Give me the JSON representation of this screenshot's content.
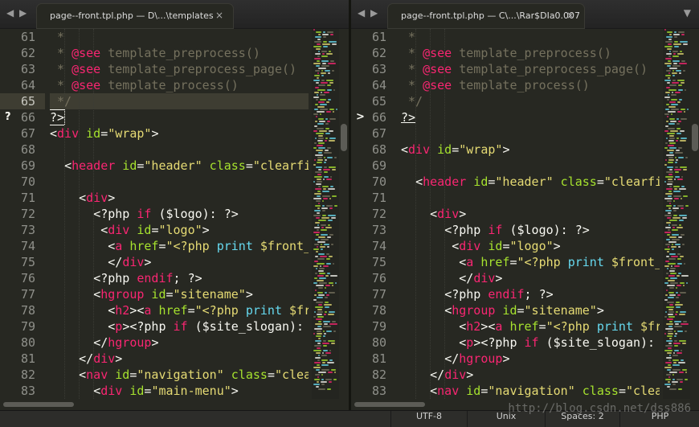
{
  "panes": [
    {
      "tab": {
        "label": "page--front.tpl.php — D\\...\\templates"
      },
      "marker": {
        "line": 66,
        "glyph": "?"
      },
      "active_line": 65,
      "line_numbers": [
        61,
        62,
        63,
        64,
        65,
        66,
        67,
        68,
        69,
        70,
        71,
        72,
        73,
        74,
        75,
        76,
        77,
        78,
        79,
        80,
        81,
        82,
        83
      ],
      "code": [
        {
          "indent": " ",
          "tokens": [
            {
              "c": "cm",
              "t": "*"
            }
          ]
        },
        {
          "indent": " ",
          "tokens": [
            {
              "c": "cm",
              "t": "* "
            },
            {
              "c": "kw",
              "t": "@see"
            },
            {
              "c": "cm",
              "t": " template_preprocess()"
            }
          ]
        },
        {
          "indent": " ",
          "tokens": [
            {
              "c": "cm",
              "t": "* "
            },
            {
              "c": "kw",
              "t": "@see"
            },
            {
              "c": "cm",
              "t": " template_preprocess_page()"
            }
          ]
        },
        {
          "indent": " ",
          "tokens": [
            {
              "c": "cm",
              "t": "* "
            },
            {
              "c": "kw",
              "t": "@see"
            },
            {
              "c": "cm",
              "t": " template_process()"
            }
          ]
        },
        {
          "indent": " ",
          "tokens": [
            {
              "c": "cm",
              "t": "*/"
            }
          ]
        },
        {
          "indent": "",
          "tokens": [
            {
              "c": "tx",
              "t": "?>",
              "caret": true
            }
          ]
        },
        {
          "indent": "",
          "tokens": [
            {
              "c": "tx",
              "t": "<"
            },
            {
              "c": "kw",
              "t": "div"
            },
            {
              "c": "at",
              "t": " id"
            },
            {
              "c": "tx",
              "t": "="
            },
            {
              "c": "st",
              "t": "\"wrap\""
            },
            {
              "c": "tx",
              "t": ">"
            }
          ]
        },
        {
          "indent": "",
          "tokens": []
        },
        {
          "indent": "  ",
          "tokens": [
            {
              "c": "tx",
              "t": "<"
            },
            {
              "c": "kw",
              "t": "header"
            },
            {
              "c": "at",
              "t": " id"
            },
            {
              "c": "tx",
              "t": "="
            },
            {
              "c": "st",
              "t": "\"header\""
            },
            {
              "c": "at",
              "t": " class"
            },
            {
              "c": "tx",
              "t": "="
            },
            {
              "c": "st",
              "t": "\"clearfi"
            }
          ]
        },
        {
          "indent": "",
          "tokens": []
        },
        {
          "indent": "    ",
          "tokens": [
            {
              "c": "tx",
              "t": "<"
            },
            {
              "c": "kw",
              "t": "div"
            },
            {
              "c": "tx",
              "t": ">"
            }
          ]
        },
        {
          "indent": "      ",
          "tokens": [
            {
              "c": "tx",
              "t": "<?php "
            },
            {
              "c": "kw",
              "t": "if"
            },
            {
              "c": "tx",
              "t": " ($logo): ?>"
            }
          ]
        },
        {
          "indent": "       ",
          "tokens": [
            {
              "c": "tx",
              "t": "<"
            },
            {
              "c": "kw",
              "t": "div"
            },
            {
              "c": "at",
              "t": " id"
            },
            {
              "c": "tx",
              "t": "="
            },
            {
              "c": "st",
              "t": "\"logo\""
            },
            {
              "c": "tx",
              "t": ">"
            }
          ]
        },
        {
          "indent": "        ",
          "tokens": [
            {
              "c": "tx",
              "t": "<"
            },
            {
              "c": "kw",
              "t": "a"
            },
            {
              "c": "at",
              "t": " href"
            },
            {
              "c": "tx",
              "t": "="
            },
            {
              "c": "st",
              "t": "\"<?php "
            },
            {
              "c": "fn",
              "t": "print"
            },
            {
              "c": "st",
              "t": " $front_"
            }
          ]
        },
        {
          "indent": "        ",
          "tokens": [
            {
              "c": "tx",
              "t": "</"
            },
            {
              "c": "kw",
              "t": "div"
            },
            {
              "c": "tx",
              "t": ">"
            }
          ]
        },
        {
          "indent": "      ",
          "tokens": [
            {
              "c": "tx",
              "t": "<?php "
            },
            {
              "c": "kw",
              "t": "endif"
            },
            {
              "c": "tx",
              "t": "; ?>"
            }
          ]
        },
        {
          "indent": "      ",
          "tokens": [
            {
              "c": "tx",
              "t": "<"
            },
            {
              "c": "kw",
              "t": "hgroup"
            },
            {
              "c": "at",
              "t": " id"
            },
            {
              "c": "tx",
              "t": "="
            },
            {
              "c": "st",
              "t": "\"sitename\""
            },
            {
              "c": "tx",
              "t": ">"
            }
          ]
        },
        {
          "indent": "        ",
          "tokens": [
            {
              "c": "tx",
              "t": "<"
            },
            {
              "c": "kw",
              "t": "h2"
            },
            {
              "c": "tx",
              "t": "><"
            },
            {
              "c": "kw",
              "t": "a"
            },
            {
              "c": "at",
              "t": " href"
            },
            {
              "c": "tx",
              "t": "="
            },
            {
              "c": "st",
              "t": "\"<?php "
            },
            {
              "c": "fn",
              "t": "print"
            },
            {
              "c": "st",
              "t": " $fr"
            }
          ]
        },
        {
          "indent": "        ",
          "tokens": [
            {
              "c": "tx",
              "t": "<"
            },
            {
              "c": "kw",
              "t": "p"
            },
            {
              "c": "tx",
              "t": "><?php "
            },
            {
              "c": "kw",
              "t": "if"
            },
            {
              "c": "tx",
              "t": " ($site_slogan): "
            }
          ]
        },
        {
          "indent": "      ",
          "tokens": [
            {
              "c": "tx",
              "t": "</"
            },
            {
              "c": "kw",
              "t": "hgroup"
            },
            {
              "c": "tx",
              "t": ">"
            }
          ]
        },
        {
          "indent": "    ",
          "tokens": [
            {
              "c": "tx",
              "t": "</"
            },
            {
              "c": "kw",
              "t": "div"
            },
            {
              "c": "tx",
              "t": ">"
            }
          ]
        },
        {
          "indent": "    ",
          "tokens": [
            {
              "c": "tx",
              "t": "<"
            },
            {
              "c": "kw",
              "t": "nav"
            },
            {
              "c": "at",
              "t": " id"
            },
            {
              "c": "tx",
              "t": "="
            },
            {
              "c": "st",
              "t": "\"navigation\""
            },
            {
              "c": "at",
              "t": " class"
            },
            {
              "c": "tx",
              "t": "="
            },
            {
              "c": "st",
              "t": "\"clea"
            }
          ]
        },
        {
          "indent": "      ",
          "tokens": [
            {
              "c": "tx",
              "t": "<"
            },
            {
              "c": "kw",
              "t": "div"
            },
            {
              "c": "at",
              "t": " id"
            },
            {
              "c": "tx",
              "t": "="
            },
            {
              "c": "st",
              "t": "\"main-menu\""
            },
            {
              "c": "tx",
              "t": ">"
            }
          ]
        }
      ]
    },
    {
      "tab": {
        "label": "page--front.tpl.php — C\\...\\Rar$DIa0.007"
      },
      "marker": {
        "line": 66,
        "glyph": ">"
      },
      "active_line": null,
      "line_numbers": [
        61,
        62,
        63,
        64,
        65,
        66,
        67,
        68,
        69,
        70,
        71,
        72,
        73,
        74,
        75,
        76,
        77,
        78,
        79,
        80,
        81,
        82,
        83
      ],
      "code": [
        {
          "indent": " ",
          "tokens": [
            {
              "c": "cm",
              "t": "*"
            }
          ]
        },
        {
          "indent": " ",
          "tokens": [
            {
              "c": "cm",
              "t": "* "
            },
            {
              "c": "kw",
              "t": "@see"
            },
            {
              "c": "cm",
              "t": " template_preprocess()"
            }
          ]
        },
        {
          "indent": " ",
          "tokens": [
            {
              "c": "cm",
              "t": "* "
            },
            {
              "c": "kw",
              "t": "@see"
            },
            {
              "c": "cm",
              "t": " template_preprocess_page()"
            }
          ]
        },
        {
          "indent": " ",
          "tokens": [
            {
              "c": "cm",
              "t": "* "
            },
            {
              "c": "kw",
              "t": "@see"
            },
            {
              "c": "cm",
              "t": " template_process()"
            }
          ]
        },
        {
          "indent": " ",
          "tokens": [
            {
              "c": "cm",
              "t": "*/"
            }
          ]
        },
        {
          "indent": "",
          "tokens": [
            {
              "c": "tx",
              "t": "?>",
              "underline": true
            }
          ]
        },
        {
          "indent": "",
          "tokens": []
        },
        {
          "indent": "",
          "tokens": [
            {
              "c": "tx",
              "t": "<"
            },
            {
              "c": "kw",
              "t": "div"
            },
            {
              "c": "at",
              "t": " id"
            },
            {
              "c": "tx",
              "t": "="
            },
            {
              "c": "st",
              "t": "\"wrap\""
            },
            {
              "c": "tx",
              "t": ">"
            }
          ]
        },
        {
          "indent": "",
          "tokens": []
        },
        {
          "indent": "  ",
          "tokens": [
            {
              "c": "tx",
              "t": "<"
            },
            {
              "c": "kw",
              "t": "header"
            },
            {
              "c": "at",
              "t": " id"
            },
            {
              "c": "tx",
              "t": "="
            },
            {
              "c": "st",
              "t": "\"header\""
            },
            {
              "c": "at",
              "t": " class"
            },
            {
              "c": "tx",
              "t": "="
            },
            {
              "c": "st",
              "t": "\"clearfi"
            }
          ]
        },
        {
          "indent": "",
          "tokens": []
        },
        {
          "indent": "    ",
          "tokens": [
            {
              "c": "tx",
              "t": "<"
            },
            {
              "c": "kw",
              "t": "div"
            },
            {
              "c": "tx",
              "t": ">"
            }
          ]
        },
        {
          "indent": "      ",
          "tokens": [
            {
              "c": "tx",
              "t": "<?php "
            },
            {
              "c": "kw",
              "t": "if"
            },
            {
              "c": "tx",
              "t": " ($logo): ?>"
            }
          ]
        },
        {
          "indent": "       ",
          "tokens": [
            {
              "c": "tx",
              "t": "<"
            },
            {
              "c": "kw",
              "t": "div"
            },
            {
              "c": "at",
              "t": " id"
            },
            {
              "c": "tx",
              "t": "="
            },
            {
              "c": "st",
              "t": "\"logo\""
            },
            {
              "c": "tx",
              "t": ">"
            }
          ]
        },
        {
          "indent": "        ",
          "tokens": [
            {
              "c": "tx",
              "t": "<"
            },
            {
              "c": "kw",
              "t": "a"
            },
            {
              "c": "at",
              "t": " href"
            },
            {
              "c": "tx",
              "t": "="
            },
            {
              "c": "st",
              "t": "\"<?php "
            },
            {
              "c": "fn",
              "t": "print"
            },
            {
              "c": "st",
              "t": " $front_"
            }
          ]
        },
        {
          "indent": "        ",
          "tokens": [
            {
              "c": "tx",
              "t": "</"
            },
            {
              "c": "kw",
              "t": "div"
            },
            {
              "c": "tx",
              "t": ">"
            }
          ]
        },
        {
          "indent": "      ",
          "tokens": [
            {
              "c": "tx",
              "t": "<?php "
            },
            {
              "c": "kw",
              "t": "endif"
            },
            {
              "c": "tx",
              "t": "; ?>"
            }
          ]
        },
        {
          "indent": "      ",
          "tokens": [
            {
              "c": "tx",
              "t": "<"
            },
            {
              "c": "kw",
              "t": "hgroup"
            },
            {
              "c": "at",
              "t": " id"
            },
            {
              "c": "tx",
              "t": "="
            },
            {
              "c": "st",
              "t": "\"sitename\""
            },
            {
              "c": "tx",
              "t": ">"
            }
          ]
        },
        {
          "indent": "        ",
          "tokens": [
            {
              "c": "tx",
              "t": "<"
            },
            {
              "c": "kw",
              "t": "h2"
            },
            {
              "c": "tx",
              "t": "><"
            },
            {
              "c": "kw",
              "t": "a"
            },
            {
              "c": "at",
              "t": " href"
            },
            {
              "c": "tx",
              "t": "="
            },
            {
              "c": "st",
              "t": "\"<?php "
            },
            {
              "c": "fn",
              "t": "print"
            },
            {
              "c": "st",
              "t": " $fr"
            }
          ]
        },
        {
          "indent": "        ",
          "tokens": [
            {
              "c": "tx",
              "t": "<"
            },
            {
              "c": "kw",
              "t": "p"
            },
            {
              "c": "tx",
              "t": "><?php "
            },
            {
              "c": "kw",
              "t": "if"
            },
            {
              "c": "tx",
              "t": " ($site_slogan): "
            }
          ]
        },
        {
          "indent": "      ",
          "tokens": [
            {
              "c": "tx",
              "t": "</"
            },
            {
              "c": "kw",
              "t": "hgroup"
            },
            {
              "c": "tx",
              "t": ">"
            }
          ]
        },
        {
          "indent": "    ",
          "tokens": [
            {
              "c": "tx",
              "t": "</"
            },
            {
              "c": "kw",
              "t": "div"
            },
            {
              "c": "tx",
              "t": ">"
            }
          ]
        },
        {
          "indent": "    ",
          "tokens": [
            {
              "c": "tx",
              "t": "<"
            },
            {
              "c": "kw",
              "t": "nav"
            },
            {
              "c": "at",
              "t": " id"
            },
            {
              "c": "tx",
              "t": "="
            },
            {
              "c": "st",
              "t": "\"navigation\""
            },
            {
              "c": "at",
              "t": " class"
            },
            {
              "c": "tx",
              "t": "="
            },
            {
              "c": "st",
              "t": "\"clea"
            }
          ]
        }
      ]
    }
  ],
  "nav_icons": {
    "back": "◀",
    "forward": "▶",
    "tab_close": "×",
    "tab_menu": "▼"
  },
  "statusbar": {
    "encoding": "UTF-8",
    "line_endings": "Unix",
    "indentation": "Spaces: 2",
    "syntax": "PHP"
  },
  "watermark": "http://blog.csdn.net/dss886",
  "colors": {
    "background": "#272822",
    "comment": "#75715e",
    "keyword": "#f92672",
    "attribute": "#a6e22e",
    "string": "#e6db74",
    "function": "#66d9ef",
    "text": "#f8f8f2"
  }
}
